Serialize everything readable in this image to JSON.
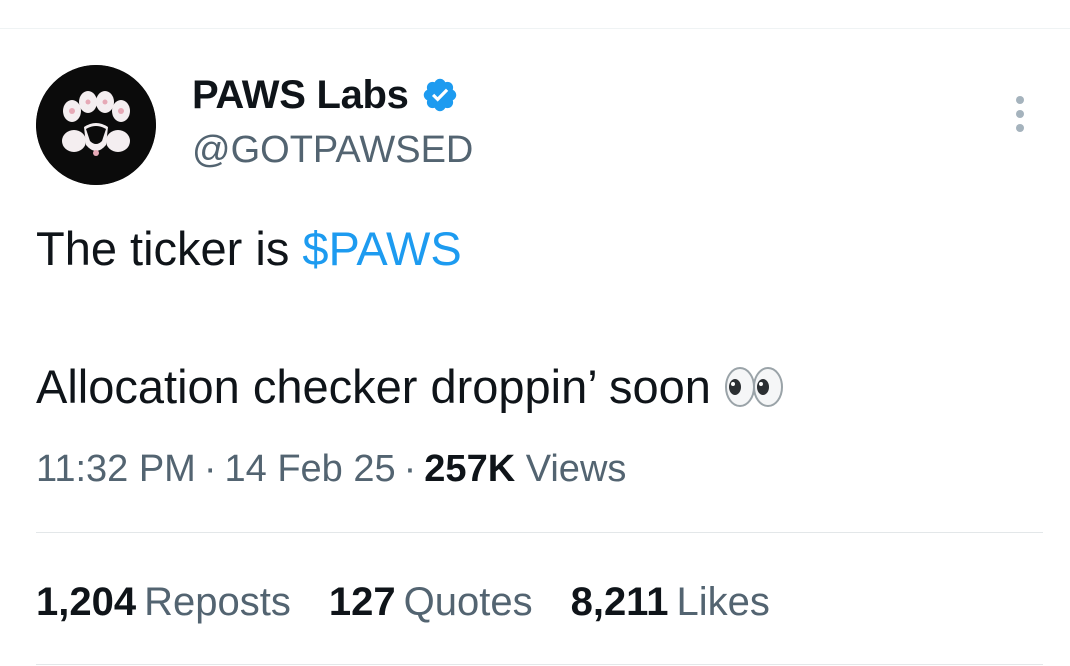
{
  "author": {
    "display_name": "PAWS Labs",
    "handle": "@GOTPAWSED",
    "verified": true,
    "avatar_icon": "paw-logo-icon"
  },
  "tweet": {
    "line1_prefix": "The ticker is ",
    "cashtag": "$PAWS",
    "line2_text": "Allocation checker droppin’ soon",
    "emoji": "eyes-emoji-icon"
  },
  "meta": {
    "time": "11:32 PM",
    "separator": "·",
    "date": "14 Feb 25",
    "views_count": "257K",
    "views_label": "Views"
  },
  "stats": {
    "reposts_count": "1,204",
    "reposts_label": "Reposts",
    "quotes_count": "127",
    "quotes_label": "Quotes",
    "likes_count": "8,211",
    "likes_label": "Likes"
  },
  "colors": {
    "text": "#0f1419",
    "secondary": "#536471",
    "accent": "#1d9bf0",
    "divider": "#e3e7e9"
  }
}
